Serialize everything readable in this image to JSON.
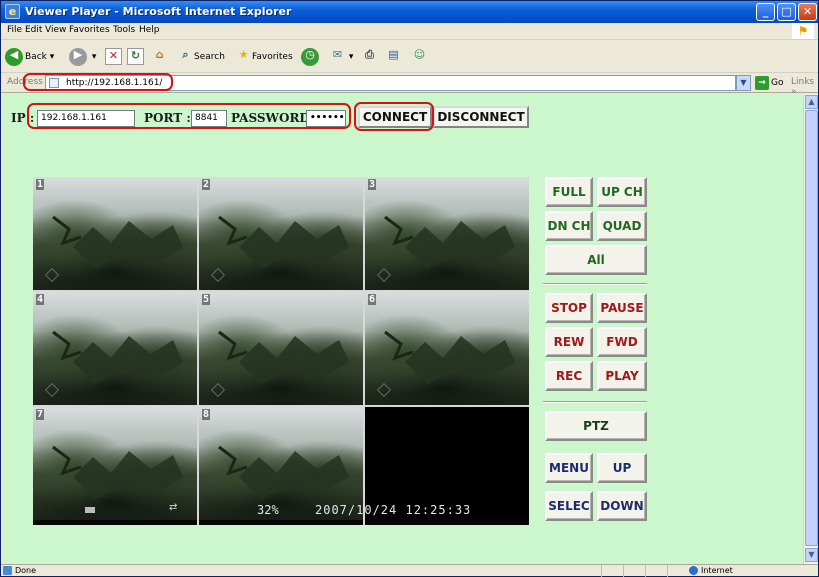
{
  "window": {
    "title": "Viewer Player - Microsoft Internet Explorer"
  },
  "menu": [
    "File",
    "Edit",
    "View",
    "Favorites",
    "Tools",
    "Help"
  ],
  "toolbar": {
    "back": "Back",
    "search": "Search",
    "favorites": "Favorites"
  },
  "address": {
    "label": "Address",
    "url": "http://192.168.1.161/",
    "go": "Go",
    "links": "Links"
  },
  "connection": {
    "ip_label": "IP :",
    "ip_value": "192.168.1.161",
    "port_label": "PORT :",
    "port_value": "8841",
    "password_label": "PASSWORD :",
    "password_value": "••••••",
    "connect": "CONNECT",
    "disconnect": "DISCONNECT"
  },
  "video": {
    "channels": [
      "1",
      "2",
      "3",
      "4",
      "5",
      "6",
      "7",
      "8"
    ],
    "osd_percent": "32%",
    "osd_timestamp": "2007/10/24  12:25:33"
  },
  "controls": {
    "full": "FULL",
    "up_ch": "UP CH",
    "dn_ch": "DN CH",
    "quad": "QUAD",
    "all": "All",
    "stop": "STOP",
    "pause": "PAUSE",
    "rew": "REW",
    "fwd": "FWD",
    "rec": "REC",
    "play": "PLAY",
    "ptz": "PTZ",
    "menu": "MENU",
    "up": "UP",
    "select": "SELEC",
    "down": "DOWN"
  },
  "status": {
    "text": "Done",
    "zone": "Internet"
  }
}
